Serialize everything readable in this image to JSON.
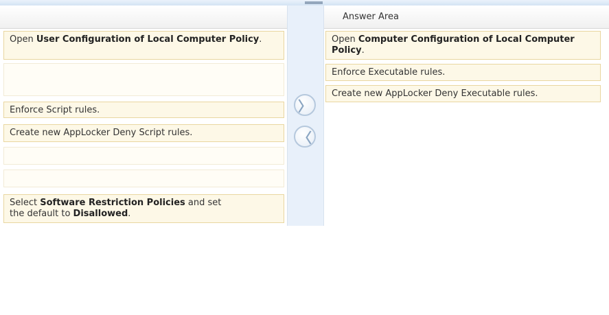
{
  "header": {
    "answer_area_title": "Answer Area"
  },
  "controls": {
    "move_right_glyph": "〉",
    "move_left_glyph": "〈"
  },
  "left_items": {
    "item1": {
      "pre": "Open ",
      "bold": "User Configuration of Local Computer Policy",
      "post": "."
    },
    "item2": {
      "text": "Enforce Script rules."
    },
    "item3": {
      "text": "Create new AppLocker Deny Script rules."
    },
    "item4": {
      "pre": "Select ",
      "bold1": "Software Restriction Policies",
      "mid": " and set the default to ",
      "bold2": "Disallowed",
      "post": "."
    }
  },
  "answer_items": {
    "item1": {
      "pre": "Open ",
      "bold": "Computer Configuration of Local Computer Policy",
      "post": "."
    },
    "item2": {
      "text": "Enforce Executable rules."
    },
    "item3": {
      "text": "Create new AppLocker Deny Executable rules."
    }
  }
}
